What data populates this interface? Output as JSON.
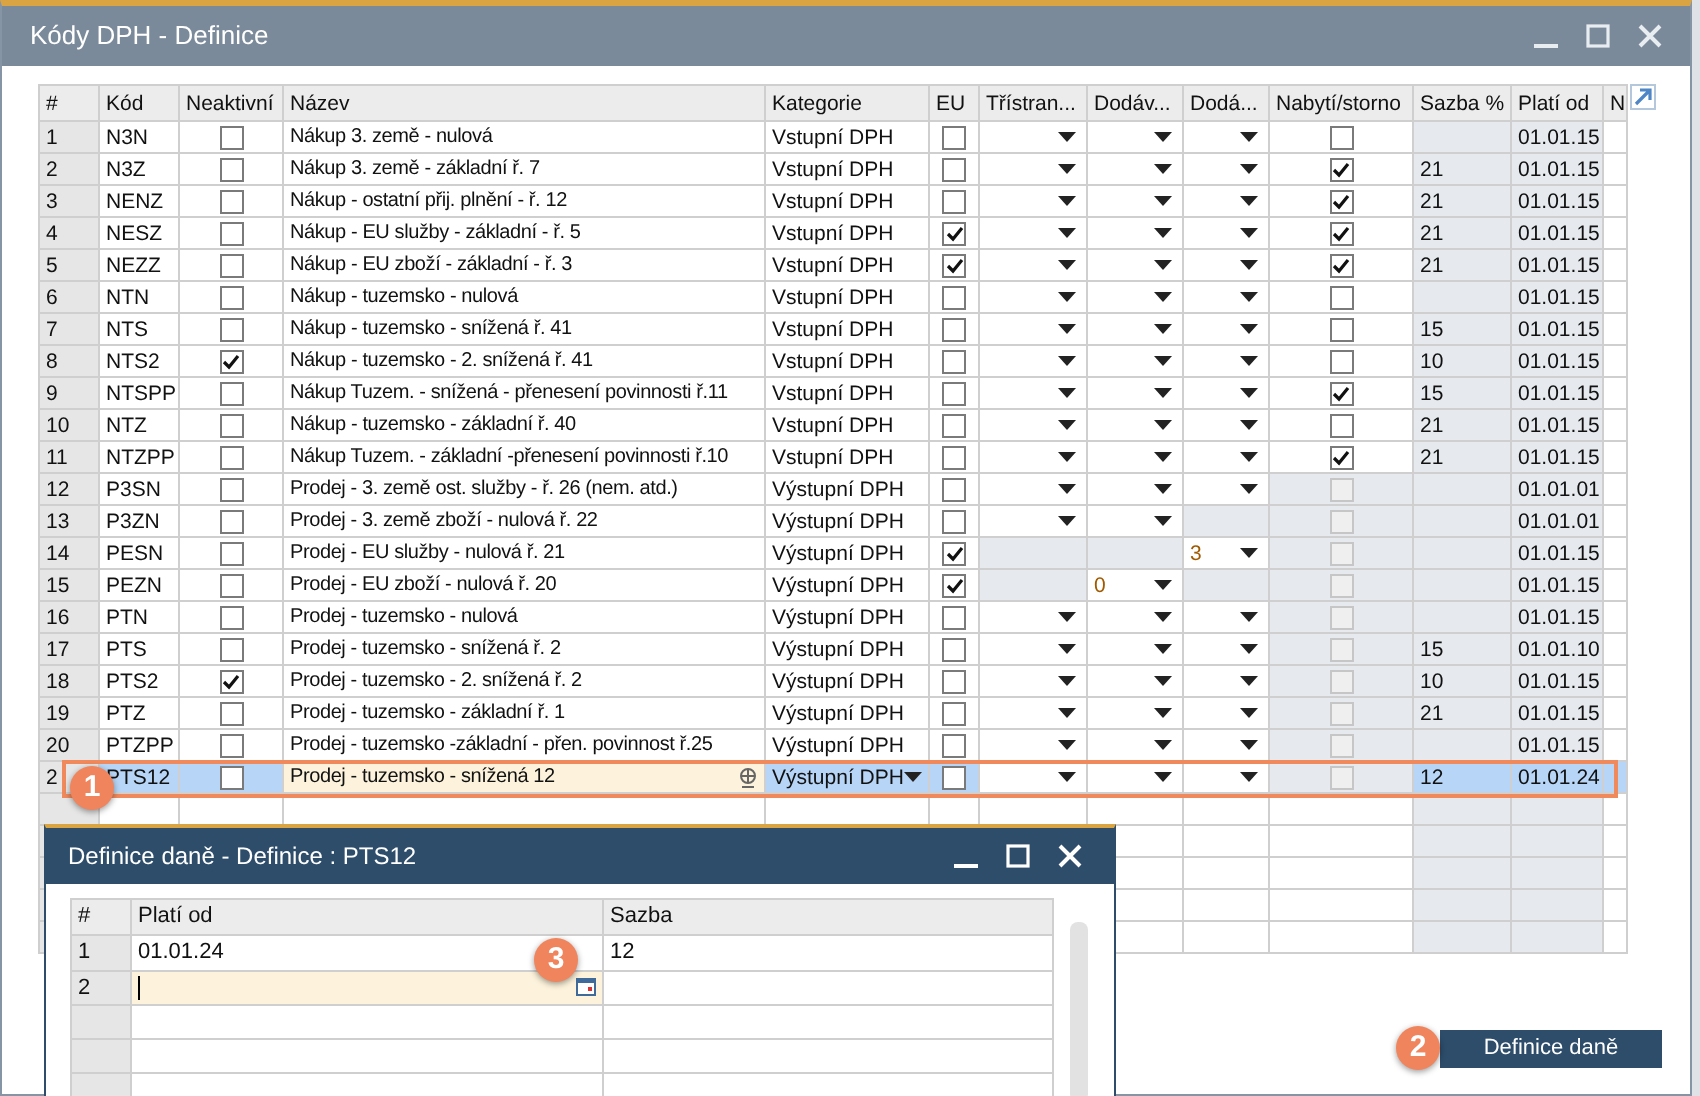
{
  "window": {
    "title": "Kódy DPH - Definice"
  },
  "table": {
    "columns": [
      "#",
      "Kód",
      "Neaktivní",
      "Název",
      "Kategorie",
      "EU",
      "Třístran...",
      "Dodáv...",
      "Dodá...",
      "Nabytí/storno",
      "Sazba %",
      "Platí od",
      "N"
    ],
    "rows": [
      {
        "num": "1",
        "code": "N3N",
        "inactive": false,
        "name": "Nákup 3. země - nulová",
        "category": "Vstupní DPH",
        "eu": false,
        "tri": {
          "disabled": false
        },
        "dodav": {
          "disabled": false
        },
        "doda": {
          "disabled": false
        },
        "nabyti": {
          "checked": false,
          "disabled": false
        },
        "rate": "",
        "valid": "01.01.15",
        "selected": false
      },
      {
        "num": "2",
        "code": "N3Z",
        "inactive": false,
        "name": "Nákup 3. země - základní ř. 7",
        "category": "Vstupní DPH",
        "eu": false,
        "tri": {
          "disabled": false
        },
        "dodav": {
          "disabled": false
        },
        "doda": {
          "disabled": false
        },
        "nabyti": {
          "checked": true,
          "disabled": false
        },
        "rate": "21",
        "valid": "01.01.15",
        "selected": false
      },
      {
        "num": "3",
        "code": "NENZ",
        "inactive": false,
        "name": "Nákup - ostatní přij. plnění - ř. 12",
        "category": "Vstupní DPH",
        "eu": false,
        "tri": {
          "disabled": false
        },
        "dodav": {
          "disabled": false
        },
        "doda": {
          "disabled": false
        },
        "nabyti": {
          "checked": true,
          "disabled": false
        },
        "rate": "21",
        "valid": "01.01.15",
        "selected": false
      },
      {
        "num": "4",
        "code": "NESZ",
        "inactive": false,
        "name": "Nákup - EU služby - základní - ř. 5",
        "category": "Vstupní DPH",
        "eu": true,
        "tri": {
          "disabled": false
        },
        "dodav": {
          "disabled": false
        },
        "doda": {
          "disabled": false
        },
        "nabyti": {
          "checked": true,
          "disabled": false
        },
        "rate": "21",
        "valid": "01.01.15",
        "selected": false
      },
      {
        "num": "5",
        "code": "NEZZ",
        "inactive": false,
        "name": "Nákup - EU zboží - základní - ř. 3",
        "category": "Vstupní DPH",
        "eu": true,
        "tri": {
          "disabled": false
        },
        "dodav": {
          "disabled": false
        },
        "doda": {
          "disabled": false
        },
        "nabyti": {
          "checked": true,
          "disabled": false
        },
        "rate": "21",
        "valid": "01.01.15",
        "selected": false
      },
      {
        "num": "6",
        "code": "NTN",
        "inactive": false,
        "name": "Nákup - tuzemsko - nulová",
        "category": "Vstupní DPH",
        "eu": false,
        "tri": {
          "disabled": false
        },
        "dodav": {
          "disabled": false
        },
        "doda": {
          "disabled": false
        },
        "nabyti": {
          "checked": false,
          "disabled": false
        },
        "rate": "",
        "valid": "01.01.15",
        "selected": false
      },
      {
        "num": "7",
        "code": "NTS",
        "inactive": false,
        "name": "Nákup - tuzemsko - snížená ř. 41",
        "category": "Vstupní DPH",
        "eu": false,
        "tri": {
          "disabled": false
        },
        "dodav": {
          "disabled": false
        },
        "doda": {
          "disabled": false
        },
        "nabyti": {
          "checked": false,
          "disabled": false
        },
        "rate": "15",
        "valid": "01.01.15",
        "selected": false
      },
      {
        "num": "8",
        "code": "NTS2",
        "inactive": true,
        "name": "Nákup - tuzemsko - 2. snížená ř. 41",
        "category": "Vstupní DPH",
        "eu": false,
        "tri": {
          "disabled": false
        },
        "dodav": {
          "disabled": false
        },
        "doda": {
          "disabled": false
        },
        "nabyti": {
          "checked": false,
          "disabled": false
        },
        "rate": "10",
        "valid": "01.01.15",
        "selected": false
      },
      {
        "num": "9",
        "code": "NTSPP",
        "inactive": false,
        "name": "Nákup Tuzem. - snížená - přenesení povinnosti ř.11",
        "category": "Vstupní DPH",
        "eu": false,
        "tri": {
          "disabled": false
        },
        "dodav": {
          "disabled": false
        },
        "doda": {
          "disabled": false
        },
        "nabyti": {
          "checked": true,
          "disabled": false
        },
        "rate": "15",
        "valid": "01.01.15",
        "selected": false
      },
      {
        "num": "10",
        "code": "NTZ",
        "inactive": false,
        "name": "Nákup - tuzemsko - základní ř. 40",
        "category": "Vstupní DPH",
        "eu": false,
        "tri": {
          "disabled": false
        },
        "dodav": {
          "disabled": false
        },
        "doda": {
          "disabled": false
        },
        "nabyti": {
          "checked": false,
          "disabled": false
        },
        "rate": "21",
        "valid": "01.01.15",
        "selected": false
      },
      {
        "num": "11",
        "code": "NTZPP",
        "inactive": false,
        "name": "Nákup Tuzem. - základní -přenesení povinnosti ř.10",
        "category": "Vstupní DPH",
        "eu": false,
        "tri": {
          "disabled": false
        },
        "dodav": {
          "disabled": false
        },
        "doda": {
          "disabled": false
        },
        "nabyti": {
          "checked": true,
          "disabled": false
        },
        "rate": "21",
        "valid": "01.01.15",
        "selected": false
      },
      {
        "num": "12",
        "code": "P3SN",
        "inactive": false,
        "name": "Prodej - 3. země ost. služby - ř. 26 (nem. atd.)",
        "category": "Výstupní DPH",
        "eu": false,
        "tri": {
          "disabled": false
        },
        "dodav": {
          "disabled": false
        },
        "doda": {
          "disabled": false
        },
        "nabyti": {
          "checked": false,
          "disabled": true
        },
        "rate": "",
        "valid": "01.01.01",
        "selected": false
      },
      {
        "num": "13",
        "code": "P3ZN",
        "inactive": false,
        "name": "Prodej - 3. země zboží - nulová ř. 22",
        "category": "Výstupní DPH",
        "eu": false,
        "tri": {
          "disabled": false
        },
        "dodav": {
          "disabled": false
        },
        "doda": {
          "disabled": true
        },
        "nabyti": {
          "checked": false,
          "disabled": true
        },
        "rate": "",
        "valid": "01.01.01",
        "selected": false
      },
      {
        "num": "14",
        "code": "PESN",
        "inactive": false,
        "name": "Prodej - EU služby - nulová ř. 21",
        "category": "Výstupní DPH",
        "eu": true,
        "tri": {
          "disabled": true
        },
        "dodav": {
          "disabled": true
        },
        "doda": {
          "disabled": false,
          "value": "3"
        },
        "nabyti": {
          "checked": false,
          "disabled": true
        },
        "rate": "",
        "valid": "01.01.15",
        "selected": false
      },
      {
        "num": "15",
        "code": "PEZN",
        "inactive": false,
        "name": "Prodej - EU zboží - nulová ř. 20",
        "category": "Výstupní DPH",
        "eu": true,
        "tri": {
          "disabled": true
        },
        "dodav": {
          "disabled": false,
          "value": "0"
        },
        "doda": {
          "disabled": true
        },
        "nabyti": {
          "checked": false,
          "disabled": true
        },
        "rate": "",
        "valid": "01.01.15",
        "selected": false
      },
      {
        "num": "16",
        "code": "PTN",
        "inactive": false,
        "name": "Prodej - tuzemsko - nulová",
        "category": "Výstupní DPH",
        "eu": false,
        "tri": {
          "disabled": false
        },
        "dodav": {
          "disabled": false
        },
        "doda": {
          "disabled": false
        },
        "nabyti": {
          "checked": false,
          "disabled": true
        },
        "rate": "",
        "valid": "01.01.15",
        "selected": false
      },
      {
        "num": "17",
        "code": "PTS",
        "inactive": false,
        "name": "Prodej - tuzemsko - snížená ř. 2",
        "category": "Výstupní DPH",
        "eu": false,
        "tri": {
          "disabled": false
        },
        "dodav": {
          "disabled": false
        },
        "doda": {
          "disabled": false
        },
        "nabyti": {
          "checked": false,
          "disabled": true
        },
        "rate": "15",
        "valid": "01.01.10",
        "selected": false
      },
      {
        "num": "18",
        "code": "PTS2",
        "inactive": true,
        "name": "Prodej - tuzemsko - 2. snížená ř. 2",
        "category": "Výstupní DPH",
        "eu": false,
        "tri": {
          "disabled": false
        },
        "dodav": {
          "disabled": false
        },
        "doda": {
          "disabled": false
        },
        "nabyti": {
          "checked": false,
          "disabled": true
        },
        "rate": "10",
        "valid": "01.01.15",
        "selected": false
      },
      {
        "num": "19",
        "code": "PTZ",
        "inactive": false,
        "name": "Prodej - tuzemsko - základní ř. 1",
        "category": "Výstupní DPH",
        "eu": false,
        "tri": {
          "disabled": false
        },
        "dodav": {
          "disabled": false
        },
        "doda": {
          "disabled": false
        },
        "nabyti": {
          "checked": false,
          "disabled": true
        },
        "rate": "21",
        "valid": "01.01.15",
        "selected": false
      },
      {
        "num": "20",
        "code": "PTZPP",
        "inactive": false,
        "name": "Prodej - tuzemsko -základní - přen. povinnost ř.25",
        "category": "Výstupní DPH",
        "eu": false,
        "tri": {
          "disabled": false
        },
        "dodav": {
          "disabled": false
        },
        "doda": {
          "disabled": false
        },
        "nabyti": {
          "checked": false,
          "disabled": true
        },
        "rate": "",
        "valid": "01.01.15",
        "selected": false
      },
      {
        "num": "2",
        "code": "PTS12",
        "inactive": false,
        "name": "Prodej - tuzemsko - snížená 12",
        "category": "Výstupní DPH",
        "eu": false,
        "tri": {
          "disabled": false
        },
        "dodav": {
          "disabled": false
        },
        "doda": {
          "disabled": false
        },
        "nabyti": {
          "checked": false,
          "disabled": true
        },
        "rate": "12",
        "valid": "01.01.24",
        "selected": true
      }
    ]
  },
  "dialog": {
    "title": "Definice daně - Definice : PTS12",
    "columns": [
      "#",
      "Platí od",
      "Sazba"
    ],
    "rows": [
      {
        "num": "1",
        "valid": "01.01.24",
        "rate": "12",
        "editing": false
      },
      {
        "num": "2",
        "editing": true
      }
    ]
  },
  "button": {
    "label": "Definice daně"
  },
  "badges": [
    "1",
    "2",
    "3"
  ]
}
